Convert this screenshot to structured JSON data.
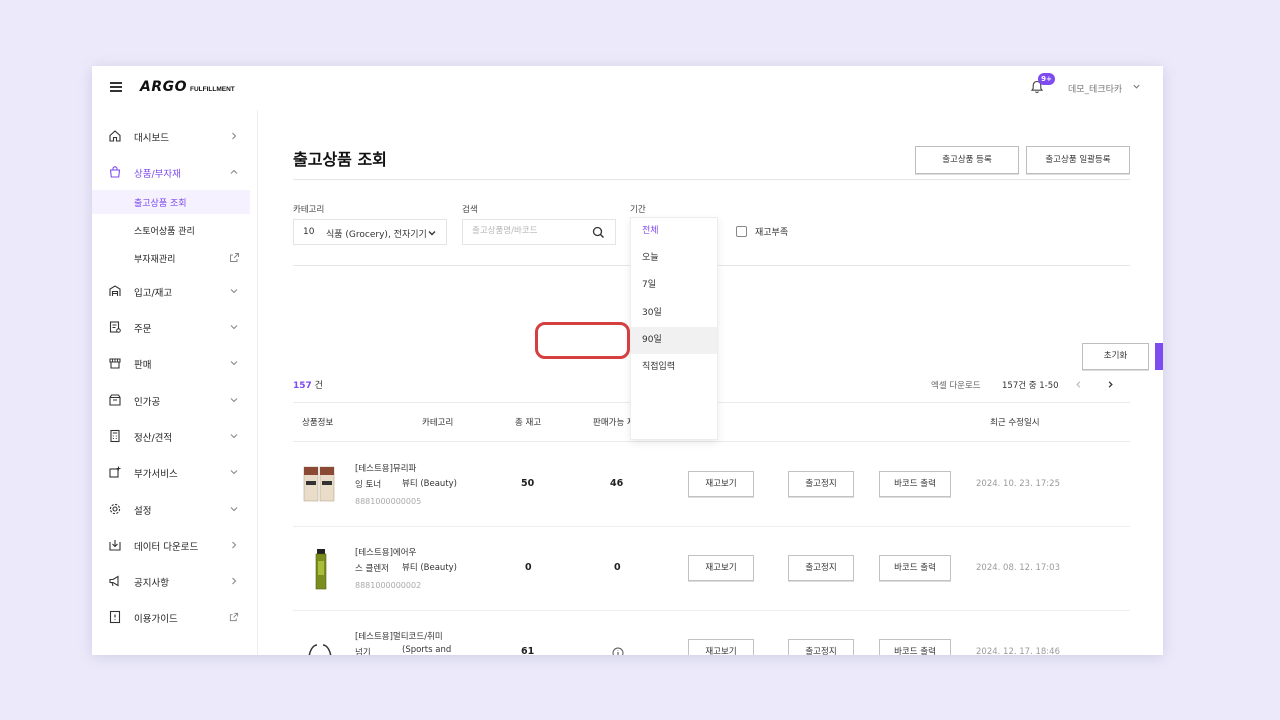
{
  "header": {
    "logo_main": "ARGO",
    "logo_sub": "FULFILLMENT",
    "notification_badge": "9+",
    "user_name": "데모_테크타카"
  },
  "sidebar": {
    "items": [
      {
        "label": "대시보드",
        "icon": "home-icon"
      },
      {
        "label": "상품/부자재",
        "icon": "bag-icon",
        "active": true
      },
      {
        "label": "입고/재고",
        "icon": "warehouse-icon"
      },
      {
        "label": "주문",
        "icon": "order-icon"
      },
      {
        "label": "판매",
        "icon": "store-icon"
      },
      {
        "label": "인가공",
        "icon": "box-icon"
      },
      {
        "label": "정산/견적",
        "icon": "calculator-icon"
      },
      {
        "label": "부가서비스",
        "icon": "plus-service-icon"
      },
      {
        "label": "설정",
        "icon": "gear-icon"
      },
      {
        "label": "데이터 다운로드",
        "icon": "download-icon"
      },
      {
        "label": "공지사항",
        "icon": "megaphone-icon"
      },
      {
        "label": "이용가이드",
        "icon": "guide-icon"
      }
    ],
    "subitems": [
      {
        "label": "출고상품 조회",
        "active": true
      },
      {
        "label": "스토어상품 관리"
      },
      {
        "label": "부자재관리"
      }
    ]
  },
  "main": {
    "title": "출고상품 조회",
    "register_button": "출고상품 등록",
    "bulk_register_button": "출고상품 일괄등록",
    "filters": {
      "category_label": "카테고리",
      "category_count": "10",
      "category_value": "식품 (Grocery), 전자기기",
      "search_label": "검색",
      "search_placeholder": "출고상품명/바코드",
      "period_label": "기간",
      "out_of_stock_label": "재고부족"
    },
    "period_options": [
      "전체",
      "오늘",
      "7일",
      "30일",
      "90일",
      "직접입력"
    ],
    "period_selected": "전체",
    "reset_button": "초기화",
    "search_button": "검색",
    "total_count": "157",
    "total_unit": "건",
    "excel_download": "엑셀 다운로드",
    "paging_text": "157건 중 1-50",
    "columns": {
      "product_info": "상품정보",
      "category": "카테고리",
      "total_stock": "총 재고",
      "available_stock": "판매가능 재고",
      "last_modified": "최근 수정일시"
    },
    "row_buttons": {
      "view_stock": "재고보기",
      "stop_shipping": "출고정지",
      "print_barcode": "바코드 출력"
    },
    "rows": [
      {
        "name_line1": "[테스트용]뮤리파",
        "name_line2": "잉 토너",
        "barcode": "8881000000005",
        "category": "뷰티 (Beauty)",
        "total_stock": "50",
        "available_stock": "46",
        "modified": "2024. 10. 23. 17:25"
      },
      {
        "name_line1": "[테스트용]에어우",
        "name_line2": "스 클렌저",
        "barcode": "8881000000002",
        "category": "뷰티 (Beauty)",
        "total_stock": "0",
        "available_stock": "0",
        "modified": "2024. 08. 12. 17:03"
      },
      {
        "name_line1": "[테스트용]멀티코드/취미",
        "name_line2": "넘기",
        "barcode": "",
        "category": "(Sports and",
        "total_stock": "61",
        "available_stock": "",
        "modified": "2024. 12. 17. 18:46"
      }
    ]
  },
  "colors": {
    "accent": "#7D4BEF",
    "highlight_ring": "#D43F3F",
    "page_background": "#ECEAFA"
  }
}
